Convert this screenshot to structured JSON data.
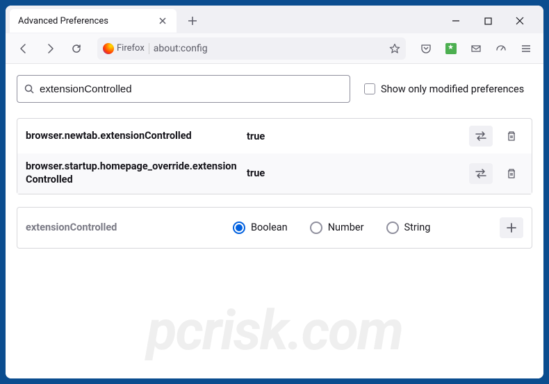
{
  "tab": {
    "title": "Advanced Preferences"
  },
  "url": {
    "label": "Firefox",
    "address": "about:config"
  },
  "search": {
    "value": "extensionControlled"
  },
  "modifiedOnly": {
    "label": "Show only modified preferences"
  },
  "prefs": [
    {
      "name": "browser.newtab.extensionControlled",
      "value": "true"
    },
    {
      "name": "browser.startup.homepage_override.extensionControlled",
      "value": "true"
    }
  ],
  "newPref": {
    "name": "extensionControlled",
    "types": {
      "boolean": "Boolean",
      "number": "Number",
      "string": "String"
    },
    "selected": "boolean"
  },
  "watermark": "pcrisk.com"
}
